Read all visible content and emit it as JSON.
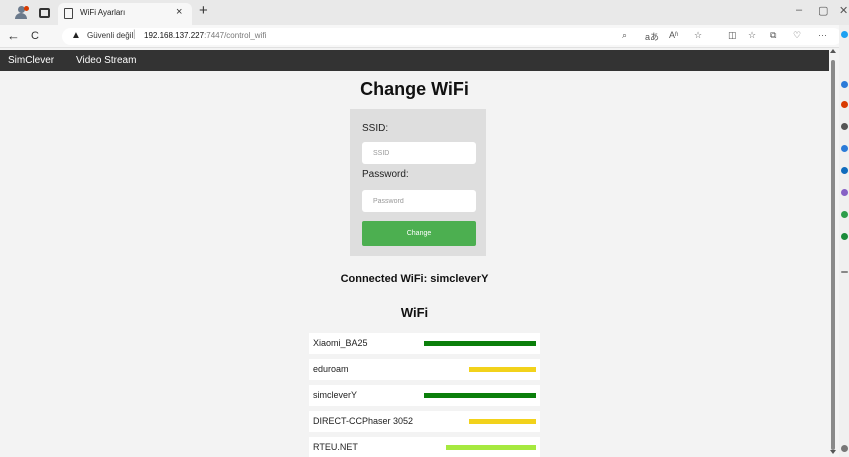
{
  "browser": {
    "tab_title": "WiFi Ayarları",
    "tab_close": "×",
    "new_tab": "+",
    "window_controls": {
      "minimize": "–",
      "maximize": "▢",
      "close": "✕"
    },
    "nav": {
      "back": "←",
      "refresh": "C"
    },
    "security_text": "Güvenli değil",
    "separator": "|",
    "url_host": "192.168.137.227",
    "url_rest": ":7447/control_wifi",
    "toolbar_icons": [
      "search-icon",
      "translate-icon",
      "read-aloud-icon",
      "favorite-icon",
      "split-screen-icon",
      "favorites-icon",
      "collections-icon",
      "browser-essentials-icon",
      "more-icon"
    ],
    "toolbar_glyphs": {
      "search": "⌕",
      "translate": "aあ",
      "read_aloud": "Aʱ",
      "favorite": "☆",
      "split": "◫",
      "favorites": "☆",
      "collections": "⧉",
      "essentials": "♡",
      "more": "···"
    }
  },
  "navbar": {
    "brand": "SimClever",
    "links": [
      "Video Stream"
    ]
  },
  "form": {
    "title": "Change WiFi",
    "ssid_label": "SSID:",
    "ssid_placeholder": "SSID",
    "password_label": "Password:",
    "password_placeholder": "Password",
    "submit_label": "Change"
  },
  "connected_wifi": "Connected WiFi: simcleverY",
  "wifi": {
    "title": "WiFi",
    "networks": [
      {
        "ssid": "Xiaomi_BA25",
        "signal": 1.0,
        "color": "#0b7f0b"
      },
      {
        "ssid": "eduroam",
        "signal": 0.6,
        "color": "#f2d21b"
      },
      {
        "ssid": "simcleverY",
        "signal": 1.0,
        "color": "#0b7f0b"
      },
      {
        "ssid": "DIRECT-CCPhaser 3052",
        "signal": 0.6,
        "color": "#f2d21b"
      },
      {
        "ssid": "RTEU.NET",
        "signal": 0.8,
        "color": "#a6e93f"
      }
    ]
  },
  "colors": {
    "navbar_bg": "#333333",
    "button_green": "#4caf50",
    "signal_strong": "#0b7f0b",
    "signal_medium": "#f2d21b",
    "signal_good": "#a6e93f"
  }
}
